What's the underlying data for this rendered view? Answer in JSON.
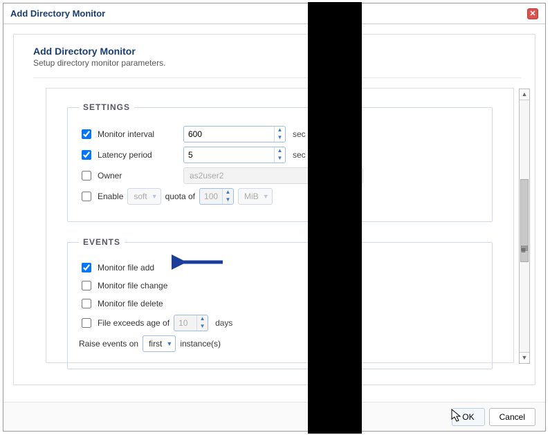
{
  "dialog": {
    "title": "Add Directory Monitor"
  },
  "panel": {
    "title": "Add Directory Monitor",
    "subtitle": "Setup directory monitor parameters."
  },
  "settings": {
    "legend": "SETTINGS",
    "monitor_interval": {
      "label": "Monitor interval",
      "value": "600",
      "unit": "sec",
      "checked": true
    },
    "latency_period": {
      "label": "Latency period",
      "value": "5",
      "unit": "sec",
      "checked": true
    },
    "owner": {
      "label": "Owner",
      "value": "as2user2",
      "checked": false
    },
    "enable": {
      "label": "Enable",
      "checked": false,
      "mode": "soft",
      "quota_label": "quota of",
      "quota_value": "100",
      "quota_unit": "MiB"
    }
  },
  "events": {
    "legend": "EVENTS",
    "file_add": {
      "label": "Monitor file add",
      "checked": true
    },
    "file_change": {
      "label": "Monitor file change",
      "checked": false
    },
    "file_delete": {
      "label": "Monitor file delete",
      "checked": false
    },
    "file_age": {
      "label": "File exceeds age of",
      "value": "10",
      "unit": "days",
      "checked": false
    },
    "raise": {
      "label": "Raise events on",
      "value": "first",
      "suffix": "instance(s)"
    }
  },
  "footer": {
    "ok": "OK",
    "cancel": "Cancel"
  }
}
